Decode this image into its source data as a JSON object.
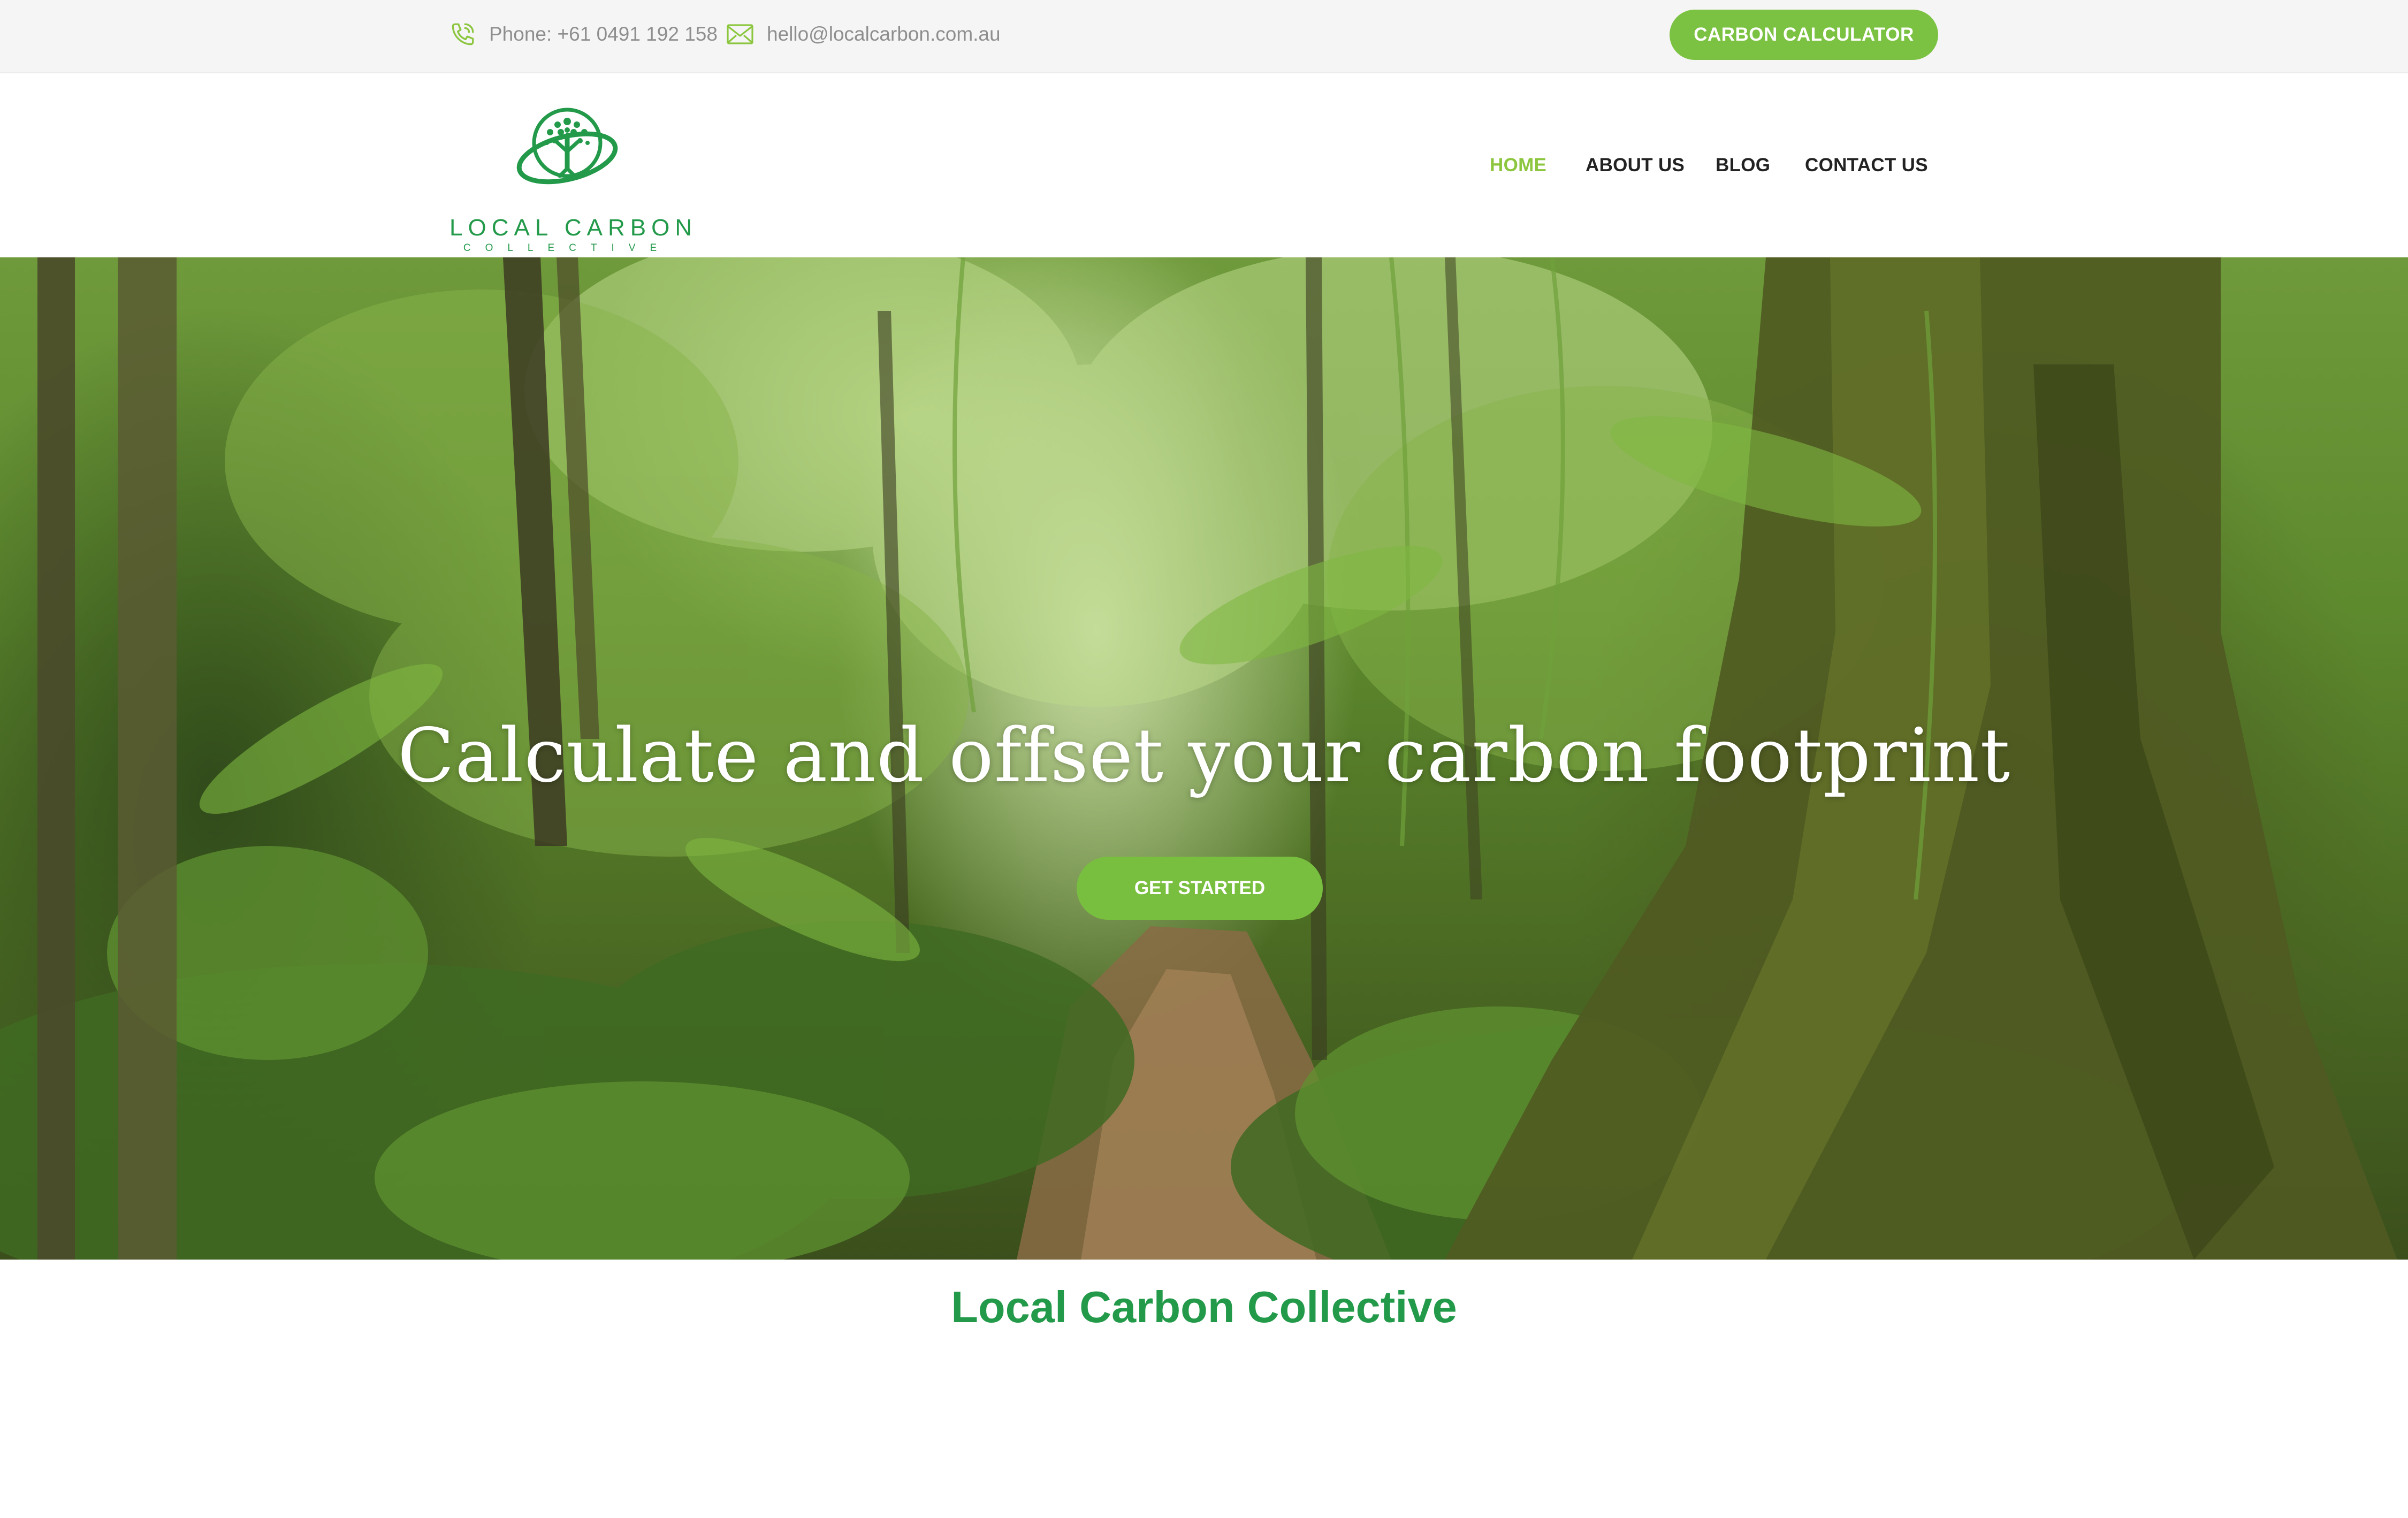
{
  "topbar": {
    "phone": "Phone: +61 0491 192 158",
    "email": "hello@localcarbon.com.au",
    "cta_label": "CARBON CALCULATOR",
    "phone_icon": "phone-icon",
    "email_icon": "envelope-icon"
  },
  "logo": {
    "name": "LOCAL CARBON",
    "sub": "COLLECTIVE"
  },
  "nav": {
    "items": [
      {
        "label": "HOME",
        "active": true
      },
      {
        "label": "ABOUT US",
        "active": false
      },
      {
        "label": "BLOG",
        "active": false
      },
      {
        "label": "CONTACT US",
        "active": false
      }
    ]
  },
  "hero": {
    "title": "Calculate and offset your carbon footprint",
    "cta_label": "GET STARTED"
  },
  "section": {
    "title": "Local Carbon Collective"
  },
  "colors": {
    "brand_green": "#239a4a",
    "accent_green": "#7cc242",
    "nav_active": "#8cc63f",
    "topbar_bg": "#f5f5f5"
  }
}
